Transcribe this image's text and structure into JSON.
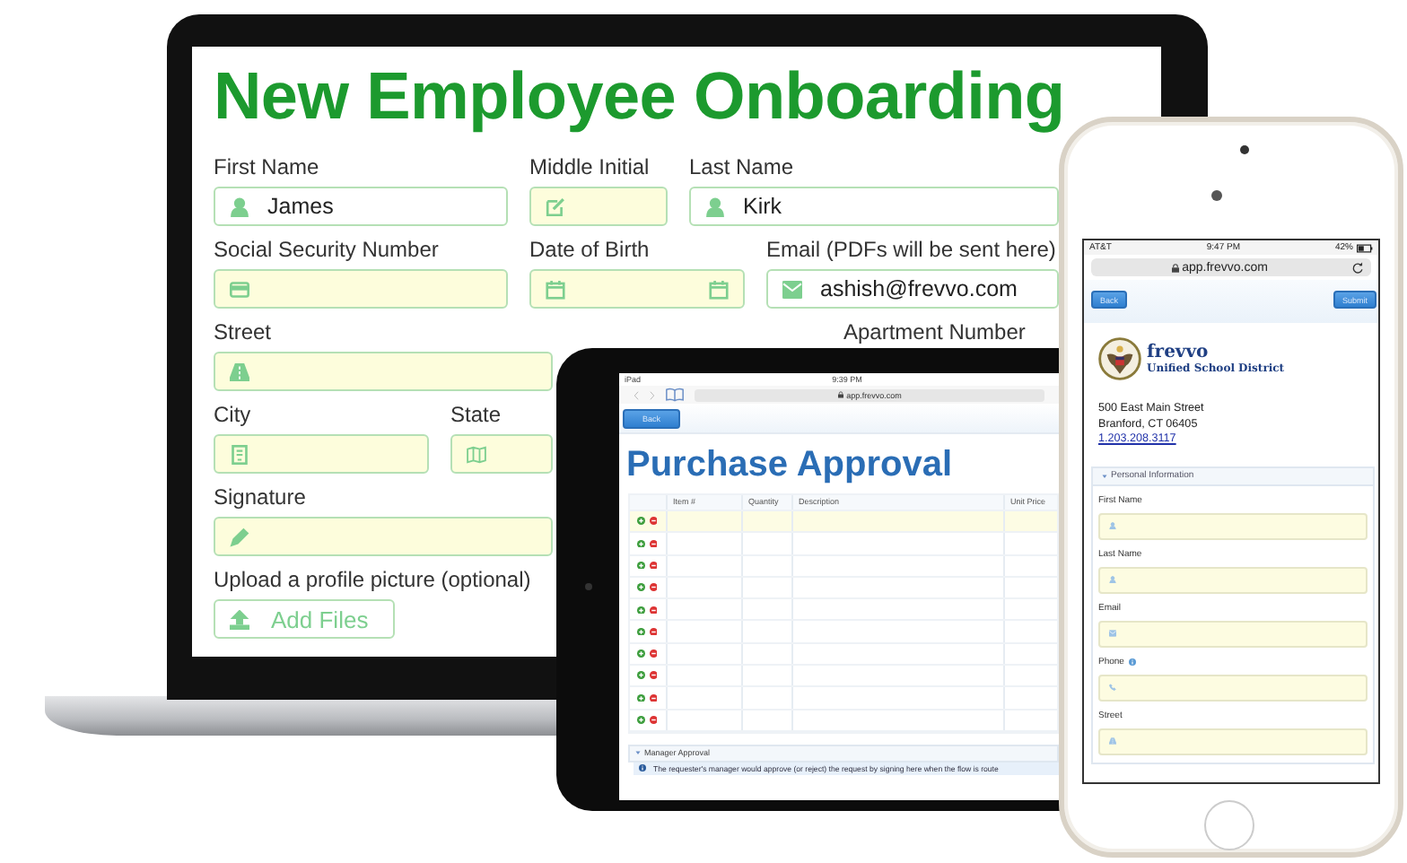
{
  "laptop": {
    "title": "New Employee Onboarding",
    "rows": [
      [
        {
          "label": "First Name",
          "kind": "person",
          "value": "James"
        },
        {
          "label": "Middle Initial",
          "kind": "edit"
        },
        {
          "label": "Last Name",
          "kind": "person",
          "value": "Kirk"
        }
      ],
      [
        {
          "label": "Social Security Number",
          "kind": "card"
        },
        {
          "label": "Date of Birth",
          "kind": "date"
        },
        {
          "label": "Email (PDFs will be sent here)",
          "kind": "email",
          "value": "ashish@frevvo.com"
        }
      ],
      [
        {
          "label": "Street",
          "kind": "road"
        },
        {
          "label": "Apartment Number",
          "kind": "none"
        }
      ],
      [
        {
          "label": "City",
          "kind": "building"
        },
        {
          "label": "State",
          "kind": "map"
        }
      ],
      [
        {
          "label": "Signature",
          "kind": "signature"
        }
      ],
      [
        {
          "label": "Upload a profile picture (optional)",
          "kind": "upload",
          "value": "Add Files"
        }
      ]
    ]
  },
  "tablet": {
    "status": {
      "carrier": "iPad",
      "time": "9:39 PM"
    },
    "url": "app.frevvo.com",
    "back_button": "Back",
    "title": "Purchase Approval",
    "columns": [
      "Item #",
      "Quantity",
      "Description",
      "Unit Price"
    ],
    "rows": [
      {
        "selected": true
      },
      {
        "selected": false
      },
      {
        "selected": false
      },
      {
        "selected": false
      },
      {
        "selected": false
      },
      {
        "selected": false
      },
      {
        "selected": false
      },
      {
        "selected": false
      },
      {
        "selected": false
      },
      {
        "selected": false
      }
    ],
    "section": {
      "title": "Manager Approval",
      "expanded": true,
      "info": "The requester's manager would approve (or reject) the request by signing here when the flow is route"
    }
  },
  "phone": {
    "status": {
      "carrier": "AT&T",
      "time": "9:47 PM",
      "battery": "42%"
    },
    "url": "app.frevvo.com",
    "back_button": "Back",
    "submit_button": "Submit",
    "org_name": "frevvo",
    "org_subtitle": "Unified School District",
    "address": [
      "500 East Main Street",
      "Branford, CT 06405"
    ],
    "phone_link": "1.203.208.3117",
    "section": {
      "title": "Personal Information",
      "expanded": true
    },
    "fields": [
      {
        "label": "First Name",
        "kind": "person",
        "info": false
      },
      {
        "label": "Last Name",
        "kind": "person",
        "info": false
      },
      {
        "label": "Email",
        "kind": "email",
        "info": false
      },
      {
        "label": "Phone",
        "kind": "phone",
        "info": true
      },
      {
        "label": "Street",
        "kind": "road",
        "info": false
      }
    ]
  }
}
